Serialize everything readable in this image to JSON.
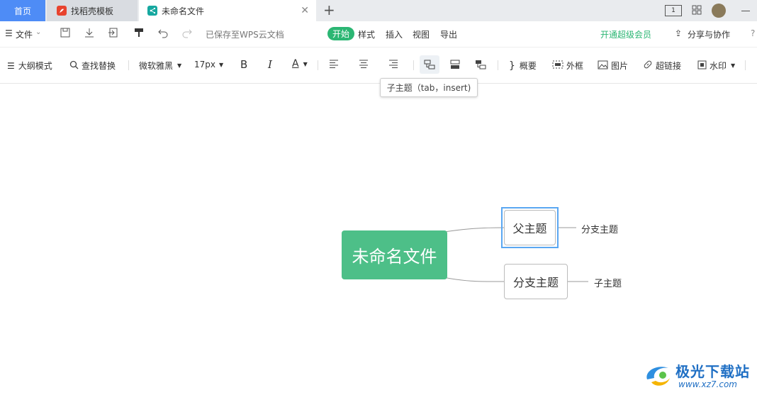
{
  "tabs": {
    "home": "首页",
    "template": "找稻壳模板",
    "doc": "未命名文件"
  },
  "menu": {
    "file": "文件",
    "saved_status": "已保存至WPS云文档",
    "start": "开始",
    "style": "样式",
    "insert": "插入",
    "view": "视图",
    "export": "导出",
    "vip": "开通超级会员",
    "share": "分享与协作"
  },
  "toolbar": {
    "outline": "大纲模式",
    "find_replace": "查找替换",
    "font_family": "微软雅黑",
    "font_size": "17px",
    "bold": "B",
    "italic": "I",
    "font_color": "A",
    "summary": "概要",
    "border_frame": "外框",
    "image": "图片",
    "hyperlink": "超链接",
    "watermark": "水印"
  },
  "tooltip": "子主题（tab，insert)",
  "mindmap": {
    "root": "未命名文件",
    "parent_topic": "父主题",
    "branch_topic": "分支主题",
    "leaf_1": "分支主题",
    "leaf_2": "子主题"
  },
  "colors": {
    "accent_green": "#4dbf88",
    "active_pill": "#2bb673",
    "home_tab": "#4e8cf6",
    "selection": "#5aa7f2"
  },
  "watermark": {
    "title": "极光下载站",
    "url": "www.xz7.com"
  }
}
